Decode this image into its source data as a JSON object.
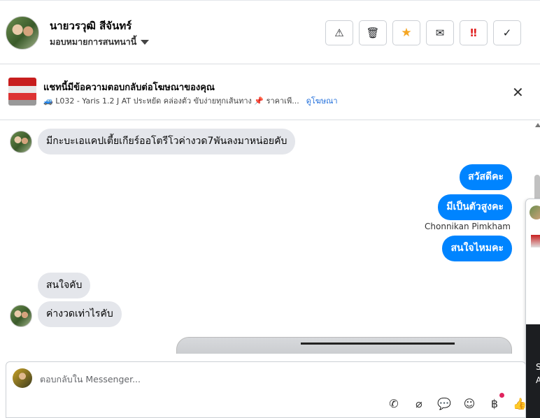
{
  "header": {
    "contact_name": "นายวรวุฒิ สีจันทร์",
    "assign_label": "มอบหมายการสนทนานี้",
    "actions": [
      {
        "name": "report-icon",
        "glyph": "⚠"
      },
      {
        "name": "trash-icon",
        "glyph": "🗑"
      },
      {
        "name": "star-icon",
        "glyph": "★"
      },
      {
        "name": "mark-unread-icon",
        "glyph": "✉"
      },
      {
        "name": "spam-icon",
        "glyph": "‼"
      },
      {
        "name": "check-icon",
        "glyph": "✓"
      }
    ]
  },
  "ad": {
    "title": "แชทนี้มีข้อความตอบกลับต่อโฆษณาของคุณ",
    "description": "🚙 L032 - Yaris 1.2 J AT ประหยัด คล่องตัว ขับง่ายทุกเส้นทาง 📌 ราคาเพี...",
    "link": "ดูโฆษณา",
    "close": "✕"
  },
  "messages": {
    "in_1": "มีกะบะเอแคปเตี้ยเกียร์ออโตรีโวค่างวด7พันลงมาหน่อยคับ",
    "out_1": "สวัสดีคะ",
    "out_2": "มีเป็นตัวสูงคะ",
    "sender": "Chonnikan Pimkham",
    "out_3": "สนใจไหมคะ",
    "in_2": "สนใจคับ",
    "in_3": "ค่างวดเท่าไรคับ"
  },
  "side_panel": {
    "dark_text": [
      "S",
      "A"
    ]
  },
  "composer": {
    "placeholder": "ตอบกลับใน Messenger...",
    "tools": [
      {
        "name": "call-icon",
        "glyph": "✆"
      },
      {
        "name": "attachment-icon",
        "glyph": "⌀"
      },
      {
        "name": "saved-reply-icon",
        "glyph": "💬"
      },
      {
        "name": "emoji-icon",
        "glyph": "☺"
      },
      {
        "name": "payment-icon",
        "glyph": "฿"
      },
      {
        "name": "like-icon",
        "glyph": "👍"
      }
    ]
  }
}
